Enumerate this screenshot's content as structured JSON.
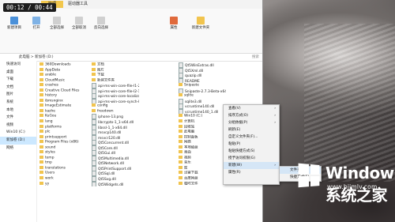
{
  "overlay": {
    "timer": "00:12 / 00:44"
  },
  "ribbon": {
    "tab_manage": "管理",
    "tab_tools": "驱动器工具",
    "buttons": [
      "新建项目",
      "打开",
      "全部选择",
      "全部取消",
      "反向选择",
      "属性",
      "新建文件夹"
    ]
  },
  "address": {
    "path": "此电脑 > 新加卷 (D:)",
    "search_placeholder": "搜索"
  },
  "sidebar": {
    "items": [
      "快速访问",
      "桌面",
      "下载",
      "文档",
      "图片",
      "系统",
      "本地",
      "文件",
      "视频",
      "Win10 (C:)",
      "新加卷 (D:)",
      "网络"
    ]
  },
  "files": {
    "col1": [
      "360Downloads",
      "AppData",
      "arable",
      "CloudMusic",
      "crashes",
      "Creative Cloud Files",
      "history",
      "ibmsnginx",
      "ImageEstimate",
      "kazhe",
      "KuGou",
      "lang",
      "platforms",
      "plc",
      "printsupport",
      "Program Files (x86)",
      "sound",
      "styles",
      "temp",
      "tmp",
      "translations",
      "Users",
      "work",
      "yy"
    ],
    "col2": [
      "文档",
      "图片",
      "下载",
      "新建文件夹",
      "api-ms-win-core-file-l1-2-0.dll",
      "api-ms-win-core-file-l2-1-0.dll",
      "api-ms-win-core-localization.dll",
      "api-ms-win-core-synch-l1-2-0.dll",
      "config",
      "freedown",
      "iphone-13.png",
      "libcrypto-1_1-x64.dll",
      "libssl-1_1-x64.dll",
      "msvcp140.dll",
      "msvcr120.dll",
      "Qt5Concurrent.dll",
      "Qt5Core.dll",
      "Qt5Gui.dll",
      "Qt5Multimedia.dll",
      "Qt5Network.dll",
      "Qt5PrintSupport.dll",
      "Qt5Sql.dll",
      "Qt5Svg.dll",
      "Qt5Widgets.dll"
    ],
    "col3": [
      "Qt5WinExtras.dll",
      "Qt5Xml.dll",
      "quazip.dll",
      "README",
      "Snipaste",
      "Snipaste-2.7.3-Beta-x64",
      "sqlite",
      "sqlite3.dll",
      "vcruntime140.dll",
      "vcruntime140_1.dll",
      "Win10 (C:)",
      "计算机",
      "回收站",
      "此电脑",
      "控制面板",
      "网络",
      "本地磁盘",
      "桌面",
      "视频",
      "音乐",
      "库",
      "迅雷下载",
      "百度网盘",
      "临时文件"
    ]
  },
  "context_menu": {
    "items": [
      "查看(V)",
      "排序方式(O)",
      "分组依据(P)",
      "刷新(E)",
      "自定义文件夹(F)...",
      "粘贴(P)",
      "粘贴快捷方式(S)",
      "授予访问权限(G)",
      "新建(W)",
      "属性(R)"
    ],
    "submenu": [
      "文件夹(F)",
      "快捷方式(S)"
    ]
  },
  "watermark": {
    "title": "Windows 系统之家",
    "url": "www.bjjmlv.com"
  }
}
